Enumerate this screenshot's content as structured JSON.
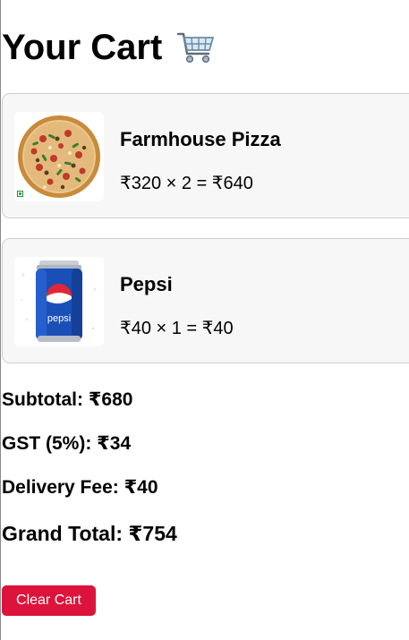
{
  "header": {
    "title": "Your Cart",
    "icon": "shopping-cart-icon"
  },
  "cart": {
    "items": [
      {
        "name": "Farmhouse Pizza",
        "line": "₹320 × 2 = ₹640",
        "image_icon": "pizza-image",
        "badge_icon": "veg-indicator-icon",
        "badge_color": "#1a8f3a"
      },
      {
        "name": "Pepsi",
        "line": "₹40 × 1 = ₹40",
        "image_icon": "pepsi-can-image"
      }
    ]
  },
  "summary": {
    "subtotal": "Subtotal: ₹680",
    "gst": "GST (5%): ₹34",
    "delivery": "Delivery Fee: ₹40",
    "grand_total": "Grand Total: ₹754"
  },
  "actions": {
    "clear_label": "Clear Cart",
    "clear_color": "#dc143c"
  }
}
